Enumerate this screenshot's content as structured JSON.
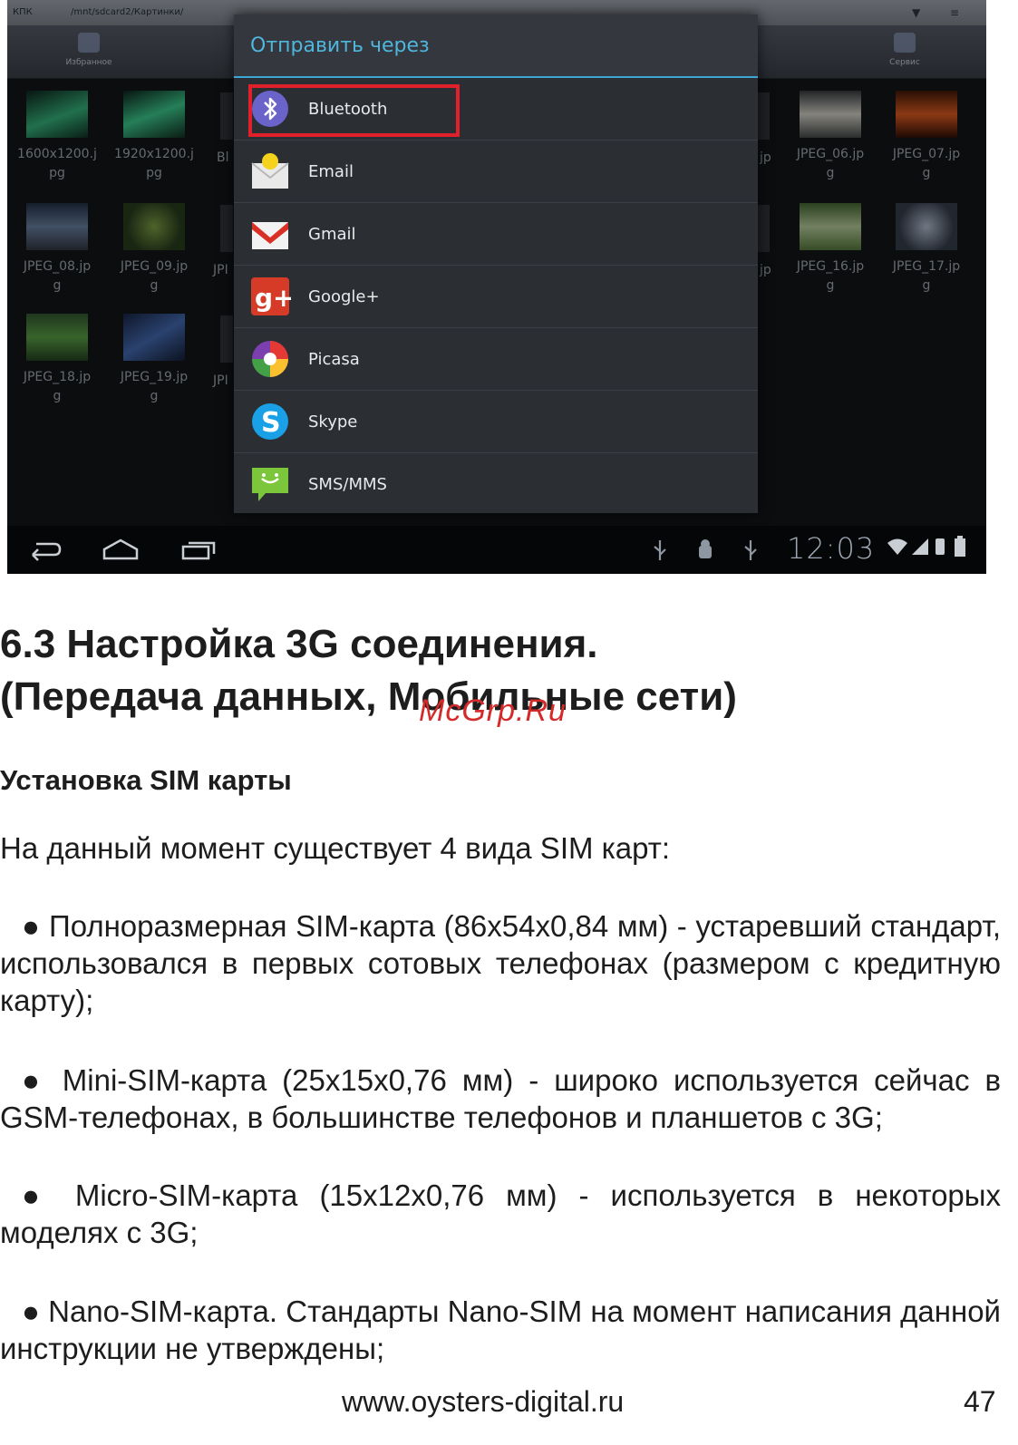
{
  "screenshot": {
    "topbar": {
      "app": "КПК",
      "path": "/mnt/sdcard2/Картинки/"
    },
    "toolbar": {
      "left_tool": "Избранное",
      "right_tool": "Сервис"
    },
    "thumbnails": [
      {
        "line1": "1600x1200.j",
        "line2": "pg"
      },
      {
        "line1": "1920x1200.j",
        "line2": "pg"
      },
      {
        "line1": "JPEG_06.jp",
        "line2": "g"
      },
      {
        "line1": "JPEG_07.jp",
        "line2": "g"
      },
      {
        "line1": "JPEG_08.jp",
        "line2": "g"
      },
      {
        "line1": "JPEG_09.jp",
        "line2": "g"
      },
      {
        "line1": "JPEG_16.jp",
        "line2": "g"
      },
      {
        "line1": "JPEG_17.jp",
        "line2": "g"
      },
      {
        "line1": "JPEG_18.jp",
        "line2": "g"
      },
      {
        "line1": "JPEG_19.jp",
        "line2": "g"
      }
    ],
    "partials": {
      "left_r1": "Bl",
      "left_r2": "JPI",
      "left_r3": "JPI",
      "right_r1": "jp",
      "right_r2": "jp"
    },
    "dialog": {
      "title": "Отправить через",
      "options": [
        {
          "label": "Bluetooth",
          "icon": "bluetooth-icon"
        },
        {
          "label": "Email",
          "icon": "email-icon"
        },
        {
          "label": "Gmail",
          "icon": "gmail-icon"
        },
        {
          "label": "Google+",
          "icon": "google-plus-icon"
        },
        {
          "label": "Picasa",
          "icon": "picasa-icon"
        },
        {
          "label": "Skype",
          "icon": "skype-icon"
        },
        {
          "label": "SMS/MMS",
          "icon": "sms-icon"
        }
      ],
      "highlight_color": "#e0202a",
      "title_color": "#4fb6dd"
    },
    "statusbar": {
      "time": "12:03"
    }
  },
  "document": {
    "heading_line1": "6.3 Настройка 3G соединения.",
    "heading_line2": "(Передача данных, Мобильные сети)",
    "watermark": "McGrp.Ru",
    "subheading": "Установка SIM карты",
    "intro": "На данный момент существует 4 вида SIM карт:",
    "bullets": [
      "● Полноразмерная SIM-карта (86x54x0,84 мм) - устаревший стандарт, использовался в первых сотовых телефонах (размером с кредитную карту);",
      "● Mini-SIM-карта (25x15x0,76 мм) - широко используется сейчас в GSM-телефонах, в большинстве телефонов и планшетов с 3G;",
      "● Micro-SIM-карта (15x12x0,76 мм) - используется в некоторых моделях с 3G;",
      "● Nano-SIM-карта. Стандарты Nano-SIM на момент написания данной инструкции не утверждены;"
    ],
    "footer_url": "www.oysters-digital.ru",
    "page_number": "47"
  }
}
